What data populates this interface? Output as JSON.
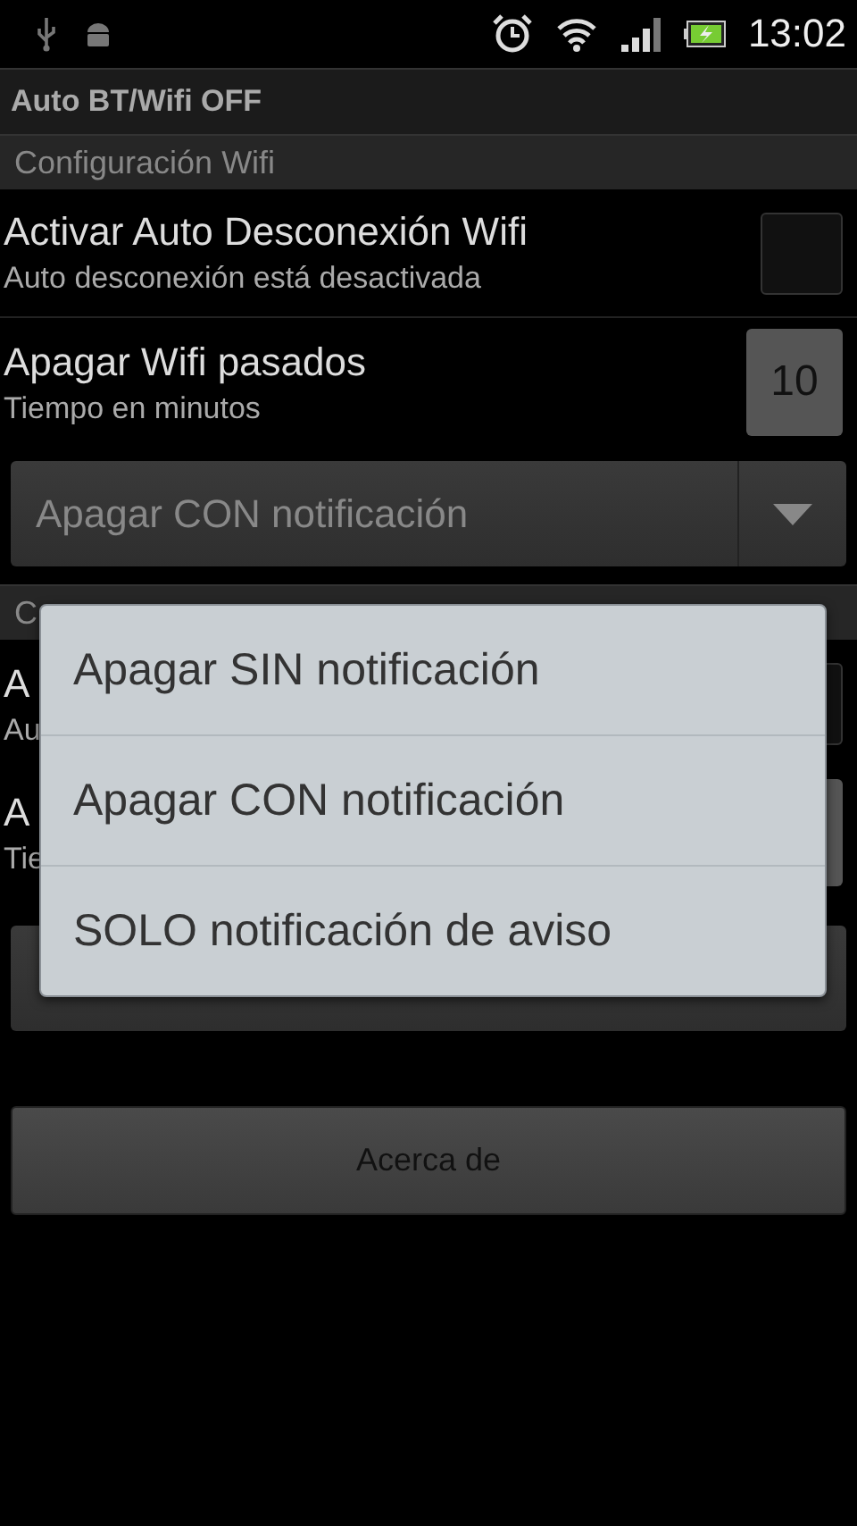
{
  "status_bar": {
    "time": "13:02"
  },
  "app_bar": {
    "title": "Auto BT/Wifi OFF"
  },
  "section": {
    "title": "Configuración Wifi"
  },
  "settings": [
    {
      "kind": "checkbox",
      "title": "Activar Auto Desconexión Wifi",
      "summary": "Auto desconexión está desactivada",
      "checked": false
    },
    {
      "kind": "number",
      "title": "Apagar Wifi pasados",
      "summary": "Tiempo en minutos",
      "value": "10"
    }
  ],
  "spinner": {
    "value": "Apagar CON notificación"
  },
  "hidden_section": {
    "title": "C",
    "rows": [
      {
        "kind": "checkbox",
        "title": "A",
        "summary": "Au",
        "checked": false
      },
      {
        "kind": "number",
        "title": "A",
        "summary": "Tie"
      }
    ]
  },
  "about_button": "Acerca de",
  "popup": {
    "options": [
      {
        "label": "Apagar SIN notificación",
        "selected": false
      },
      {
        "label": "Apagar CON notificación",
        "selected": false
      },
      {
        "label": "SOLO notificación de aviso",
        "selected": false
      }
    ]
  }
}
